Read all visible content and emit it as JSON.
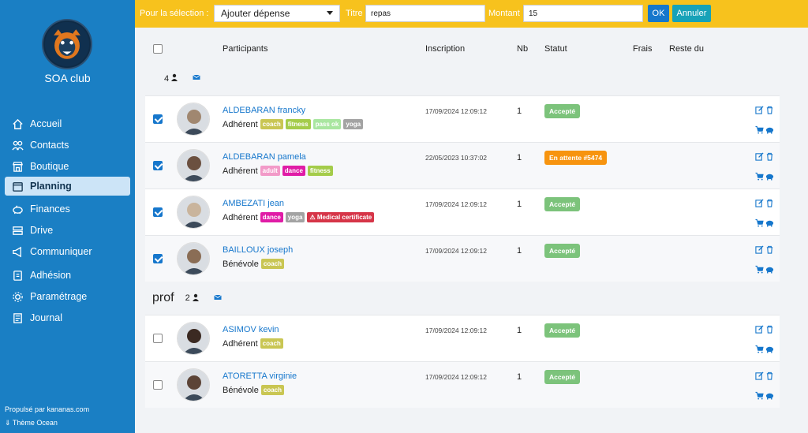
{
  "sidebar": {
    "club_name": "SOA club",
    "items": [
      {
        "label": "Accueil",
        "icon": "house-icon"
      },
      {
        "label": "Contacts",
        "icon": "users-icon"
      },
      {
        "label": "Boutique",
        "icon": "store-icon"
      },
      {
        "label": "Planning",
        "icon": "calendar-icon",
        "active": true
      },
      {
        "label": "Finances",
        "icon": "piggy-bank-icon"
      },
      {
        "label": "Drive",
        "icon": "drive-icon"
      },
      {
        "label": "Communiquer",
        "icon": "megaphone-icon"
      },
      {
        "label": "Adhésion",
        "icon": "id-card-icon"
      },
      {
        "label": "Paramétrage",
        "icon": "gear-icon"
      },
      {
        "label": "Journal",
        "icon": "journal-icon"
      }
    ],
    "powered_by": "Propulsé par kananas.com",
    "theme": "Thème Ocean"
  },
  "topbar": {
    "selection_label": "Pour la sélection :",
    "selection_value": "Ajouter dépense",
    "title_label": "Titre",
    "title_value": "repas",
    "amount_label": "Montant",
    "amount_value": "15",
    "ok_label": "OK",
    "cancel_label": "Annuler",
    "accent_color": "#f7c21d"
  },
  "table": {
    "headers": {
      "participants": "Participants",
      "inscription": "Inscription",
      "nb": "Nb",
      "statut": "Statut",
      "frais": "Frais",
      "reste": "Reste du"
    },
    "groups": [
      {
        "name": "",
        "count": "4",
        "rows": [
          {
            "name": "ALDEBARAN francky",
            "role": "Adhérent",
            "tags": [
              [
                "coach",
                "coach"
              ],
              [
                "fitness",
                "fitness"
              ],
              [
                "pass ok",
                "passok"
              ],
              [
                "yoga",
                "yoga"
              ]
            ],
            "date": "17/09/2024 12:09:12",
            "nb": "1",
            "status": "Accepté",
            "status_type": "ok",
            "checked": true
          },
          {
            "name": "ALDEBARAN pamela",
            "role": "Adhérent",
            "tags": [
              [
                "adult",
                "adult"
              ],
              [
                "dance",
                "dance"
              ],
              [
                "fitness",
                "fitness"
              ]
            ],
            "date": "22/05/2023 10:37:02",
            "nb": "1",
            "status": "En attente #5474",
            "status_type": "wait",
            "checked": true
          },
          {
            "name": "AMBEZATI jean",
            "role": "Adhérent",
            "tags": [
              [
                "dance",
                "dance"
              ],
              [
                "yoga",
                "yoga"
              ],
              [
                "⚠ Medical certificate",
                "medical"
              ]
            ],
            "date": "17/09/2024 12:09:12",
            "nb": "1",
            "status": "Accepté",
            "status_type": "ok",
            "checked": true
          },
          {
            "name": "BAILLOUX joseph",
            "role": "Bénévole",
            "tags": [
              [
                "coach",
                "coach"
              ]
            ],
            "date": "17/09/2024 12:09:12",
            "nb": "1",
            "status": "Accepté",
            "status_type": "ok",
            "checked": true
          }
        ]
      },
      {
        "name": "prof",
        "count": "2",
        "rows": [
          {
            "name": "ASIMOV kevin",
            "role": "Adhérent",
            "tags": [
              [
                "coach",
                "coach"
              ]
            ],
            "date": "17/09/2024 12:09:12",
            "nb": "1",
            "status": "Accepté",
            "status_type": "ok",
            "checked": false
          },
          {
            "name": "ATORETTA virginie",
            "role": "Bénévole",
            "tags": [
              [
                "coach",
                "coach"
              ]
            ],
            "date": "17/09/2024 12:09:12",
            "nb": "1",
            "status": "Accepté",
            "status_type": "ok",
            "checked": false
          }
        ]
      }
    ]
  }
}
